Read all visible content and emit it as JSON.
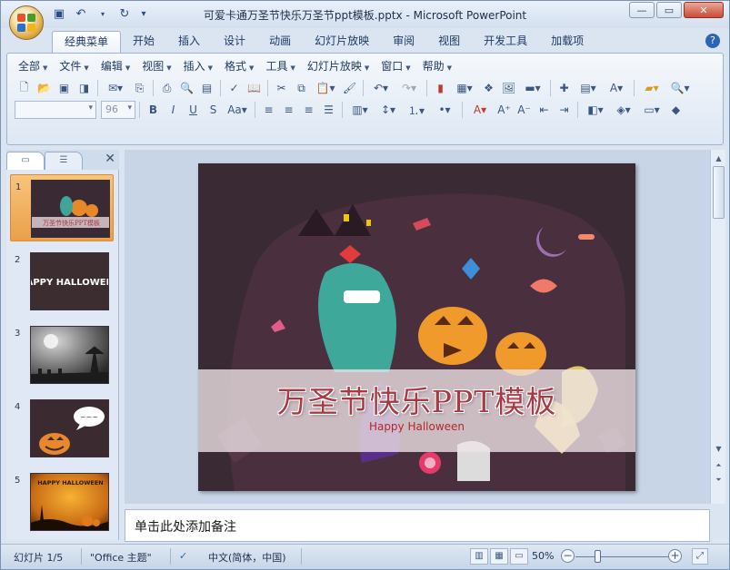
{
  "window": {
    "title": "可爱卡通万圣节快乐万圣节ppt模板.pptx - Microsoft PowerPoint",
    "controls": {
      "minimize": "—",
      "maximize": "▭",
      "close": "✕"
    }
  },
  "quick_access": [
    {
      "icon": "save-icon",
      "glyph": "💾"
    },
    {
      "icon": "undo-icon",
      "glyph": "↶"
    },
    {
      "icon": "dropdown-arrow-icon",
      "glyph": "▾"
    },
    {
      "icon": "redo-icon",
      "glyph": "↻"
    },
    {
      "icon": "customize-icon",
      "glyph": "="
    }
  ],
  "ribbon_tabs": [
    "经典菜单",
    "开始",
    "插入",
    "设计",
    "动画",
    "幻灯片放映",
    "审阅",
    "视图",
    "开发工具",
    "加载项"
  ],
  "active_tab": "经典菜单",
  "classic_menus": [
    "全部",
    "文件",
    "编辑",
    "视图",
    "插入",
    "格式",
    "工具",
    "幻灯片放映",
    "窗口",
    "帮助"
  ],
  "toolbar": {
    "font_name": "",
    "font_size": "96",
    "row2_icons": [
      "new-icon",
      "open-icon",
      "save-icon",
      "permission-icon",
      "print-preview-icon",
      "research-icon",
      "print-icon",
      "print-preview2-icon",
      "page-setup-icon",
      "spelling-icon",
      "research2-icon",
      "cut-icon",
      "copy-icon",
      "paste-icon",
      "format-painter-icon",
      "undo-icon",
      "redo-icon",
      "chart-icon",
      "table-icon",
      "clipart-icon",
      "picture-icon",
      "color-icon",
      "new-slide-icon",
      "layout-icon",
      "textbox-icon",
      "open-folder-icon",
      "find-icon"
    ],
    "row3_icons": [
      "bold-icon",
      "italic-icon",
      "underline-icon",
      "strikethrough-icon",
      "case-icon",
      "align-left-icon",
      "center-icon",
      "align-right-icon",
      "justify-icon",
      "columns-icon",
      "line-spacing-icon",
      "bullets-icon",
      "numbering-icon",
      "font-color-icon",
      "grow-font-icon",
      "shrink-font-icon",
      "decrease-indent-icon",
      "increase-indent-icon",
      "shapes-icon",
      "arrange-icon",
      "quick-styles-icon",
      "fill-icon"
    ]
  },
  "slides_panel": {
    "tabs": [
      "slides-tab-icon",
      "outline-tab-icon"
    ],
    "close": "✕",
    "slides": [
      {
        "number": "1",
        "thumb_text": "万圣节快乐PPT模板",
        "selected": true
      },
      {
        "number": "2",
        "thumb_text": "HAPPY HALLOWEEN"
      },
      {
        "number": "3",
        "thumb_text": ""
      },
      {
        "number": "4",
        "thumb_text": "~~~"
      },
      {
        "number": "5",
        "thumb_text": "HAPPY HALLOWEEN"
      }
    ]
  },
  "slide": {
    "title": "万圣节快乐PPT模板",
    "subtitle": "Happy Halloween"
  },
  "notes": {
    "placeholder": "单击此处添加备注"
  },
  "status": {
    "slide_info": "幻灯片 1/5",
    "theme": "\"Office 主题\"",
    "language": "中文(简体，中国)",
    "zoom": "50%"
  },
  "colors": {
    "accent": "#2c64b8",
    "selected_thumb": "#eaa04a",
    "title_red": "#a83a44"
  }
}
